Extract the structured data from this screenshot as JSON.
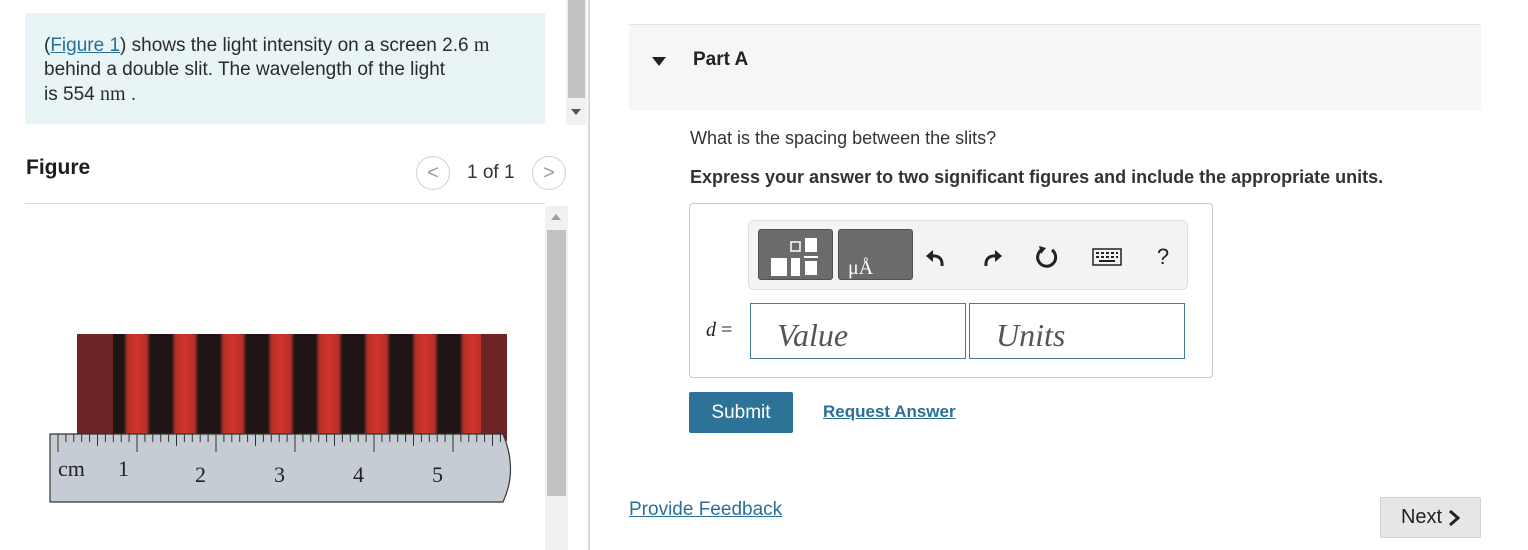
{
  "prompt": {
    "figure_link": "Figure 1",
    "text_a": ") shows the light intensity on a screen 2.6 ",
    "unit_m": "m",
    "text_b": "behind a double slit. The wavelength of the light",
    "text_c": "is 554 ",
    "unit_nm": "nm",
    "text_d": " ."
  },
  "figure": {
    "title": "Figure",
    "pager": "1 of 1",
    "prev_glyph": "<",
    "next_glyph": ">",
    "ruler_labels": [
      "cm",
      "1",
      "2",
      "3",
      "4",
      "5"
    ],
    "fringe_dark": "#1e1414",
    "fringe_bright": "#d0342a"
  },
  "part": {
    "title": "Part A",
    "question": "What is the spacing between the slits?",
    "instruction": "Express your answer to two significant figures and include the appropriate units."
  },
  "answer": {
    "variable": "d",
    "equals": " =",
    "value_placeholder": "Value",
    "units_placeholder": "Units",
    "help": "?",
    "units_tool_label": "μÅ"
  },
  "actions": {
    "submit": "Submit",
    "request_answer": "Request Answer",
    "feedback": "Provide Feedback",
    "next": "Next"
  },
  "colors": {
    "accent": "#2d7297",
    "link": "#2a6f99",
    "prompt_bg": "#e8f4f5"
  }
}
